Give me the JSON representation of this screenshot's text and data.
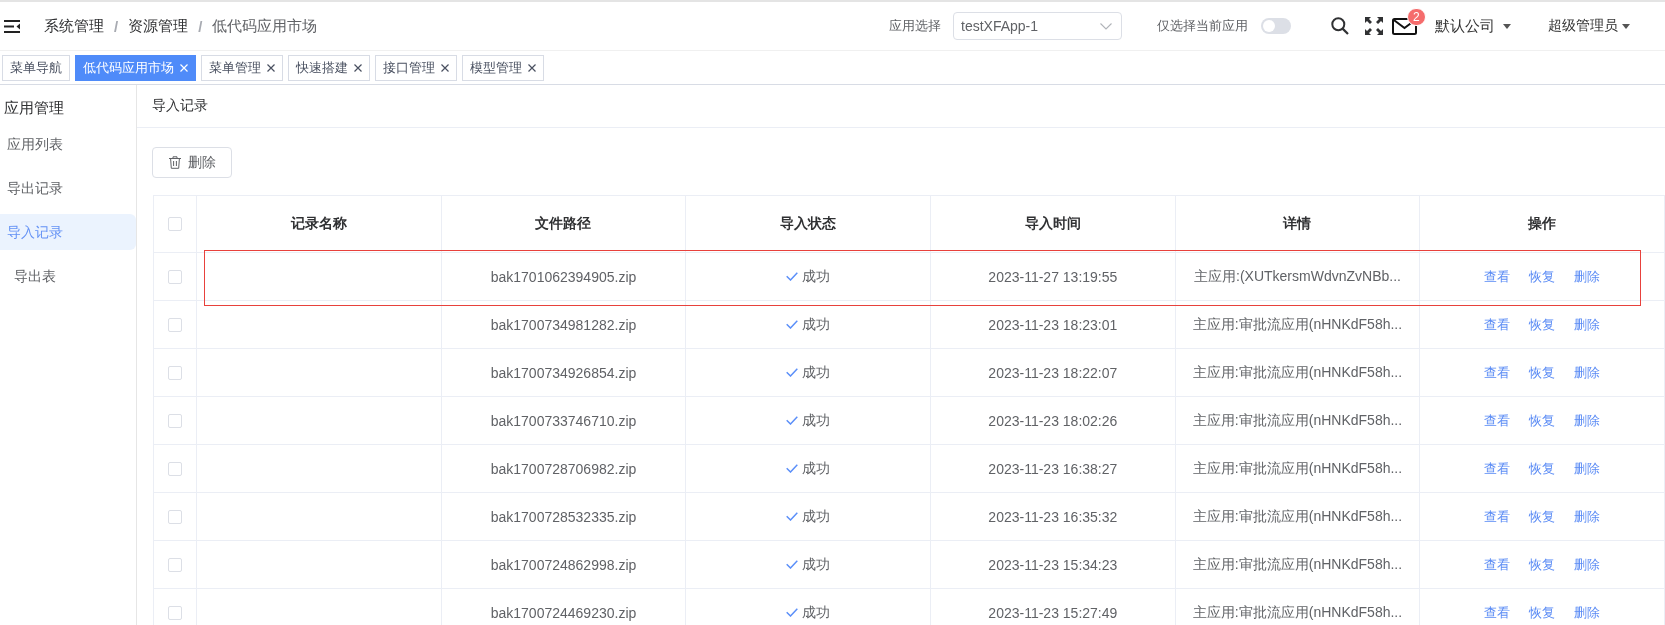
{
  "header": {
    "breadcrumb": [
      {
        "label": "系统管理",
        "separator": "/"
      },
      {
        "label": "资源管理",
        "separator": "/"
      },
      {
        "label": "低代码应用市场"
      }
    ],
    "app_select": {
      "label": "应用选择",
      "value": "testXFApp-1"
    },
    "current_app_toggle": {
      "label": "仅选择当前应用",
      "on": false
    },
    "mail_badge": "2",
    "company": "默认公司",
    "user": "超级管理员"
  },
  "tabs": [
    {
      "label": "菜单导航",
      "selected": false,
      "closable": false
    },
    {
      "label": "低代码应用市场",
      "selected": true,
      "closable": true
    },
    {
      "label": "菜单管理",
      "selected": false,
      "closable": true
    },
    {
      "label": "快速搭建",
      "selected": false,
      "closable": true
    },
    {
      "label": "接口管理",
      "selected": false,
      "closable": true
    },
    {
      "label": "模型管理",
      "selected": false,
      "closable": true
    }
  ],
  "sidebar": {
    "title": "应用管理",
    "items": [
      {
        "label": "应用列表",
        "selected": false,
        "kind": "menu"
      },
      {
        "label": "导出记录",
        "selected": false,
        "kind": "menu"
      },
      {
        "label": "导入记录",
        "selected": true,
        "kind": "menu"
      },
      {
        "label": "导出表",
        "selected": false,
        "kind": "sub"
      }
    ]
  },
  "page": {
    "title": "导入记录",
    "delete_button": "删除"
  },
  "table": {
    "all_checked": false,
    "columns": [
      "记录名称",
      "文件路径",
      "导入状态",
      "导入时间",
      "详情",
      "操作"
    ],
    "rows": [
      {
        "checked": false,
        "highlighted": true,
        "file_path": "bak1701062394905.zip",
        "status": {
          "text": "成功",
          "kind": "success"
        },
        "time": "2023-11-27 13:19:55",
        "detail": "主应用:(XUTkersmWdvnZvNBb...",
        "actions": [
          "查看",
          "恢复",
          "删除"
        ]
      },
      {
        "checked": false,
        "highlighted": false,
        "file_path": "bak1700734981282.zip",
        "status": {
          "text": "成功",
          "kind": "success"
        },
        "time": "2023-11-23 18:23:01",
        "detail": "主应用:审批流应用(nHNKdF58h...",
        "actions": [
          "查看",
          "恢复",
          "删除"
        ]
      },
      {
        "checked": false,
        "highlighted": false,
        "file_path": "bak1700734926854.zip",
        "status": {
          "text": "成功",
          "kind": "success"
        },
        "time": "2023-11-23 18:22:07",
        "detail": "主应用:审批流应用(nHNKdF58h...",
        "actions": [
          "查看",
          "恢复",
          "删除"
        ]
      },
      {
        "checked": false,
        "highlighted": false,
        "file_path": "bak1700733746710.zip",
        "status": {
          "text": "成功",
          "kind": "success"
        },
        "time": "2023-11-23 18:02:26",
        "detail": "主应用:审批流应用(nHNKdF58h...",
        "actions": [
          "查看",
          "恢复",
          "删除"
        ]
      },
      {
        "checked": false,
        "highlighted": false,
        "file_path": "bak1700728706982.zip",
        "status": {
          "text": "成功",
          "kind": "success"
        },
        "time": "2023-11-23 16:38:27",
        "detail": "主应用:审批流应用(nHNKdF58h...",
        "actions": [
          "查看",
          "恢复",
          "删除"
        ]
      },
      {
        "checked": false,
        "highlighted": false,
        "file_path": "bak1700728532335.zip",
        "status": {
          "text": "成功",
          "kind": "success"
        },
        "time": "2023-11-23 16:35:32",
        "detail": "主应用:审批流应用(nHNKdF58h...",
        "actions": [
          "查看",
          "恢复",
          "删除"
        ]
      },
      {
        "checked": false,
        "highlighted": false,
        "file_path": "bak1700724862998.zip",
        "status": {
          "text": "成功",
          "kind": "success"
        },
        "time": "2023-11-23 15:34:23",
        "detail": "主应用:审批流应用(nHNKdF58h...",
        "actions": [
          "查看",
          "恢复",
          "删除"
        ]
      },
      {
        "checked": false,
        "highlighted": false,
        "file_path": "bak1700724469230.zip",
        "status": {
          "text": "成功",
          "kind": "success"
        },
        "time": "2023-11-23 15:27:49",
        "detail": "主应用:审批流应用(nHNKdF58h...",
        "actions": [
          "查看",
          "恢复",
          "删除"
        ]
      }
    ]
  }
}
